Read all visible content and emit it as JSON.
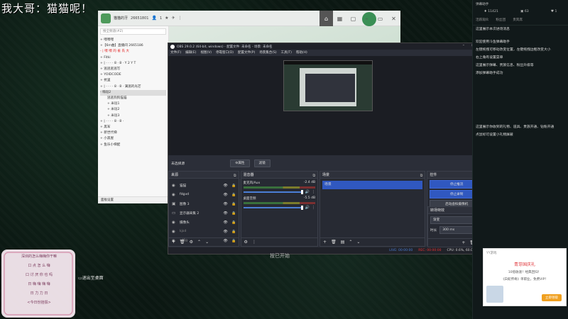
{
  "stream_title": "我大哥：猫猫呢！",
  "chat": {
    "user_name": "猫猫的牙",
    "user_id": "26651801",
    "member_count": "1",
    "search_placeholder": "搜全频道(#Z)",
    "tree": [
      {
        "label": "+ 嘿嘿嘿",
        "cls": ""
      },
      {
        "label": "+【6m曲】直播间 2665186",
        "cls": ""
      },
      {
        "label": "- | 嘿 嘿 的 雀 氏 大",
        "cls": "red"
      },
      {
        "label": "+ Fitki",
        "cls": ""
      },
      {
        "label": "+ | · · · · 8 · 8 · Y 2 Y T",
        "cls": ""
      },
      {
        "label": "+ 逃逃逃逃写",
        "cls": ""
      },
      {
        "label": "+ YOIDCODE",
        "cls": ""
      },
      {
        "label": "+ 抗里",
        "cls": ""
      },
      {
        "label": "+ | · · · · 8 · 8 · 满逃的光芒",
        "cls": ""
      },
      {
        "label": "- 嗨逗2",
        "cls": "hl"
      },
      {
        "label": "逃逃狗狗猫猫",
        "cls": "sub"
      },
      {
        "label": "+ 米逗1",
        "cls": "sub"
      },
      {
        "label": "+ 米逗2",
        "cls": "sub"
      },
      {
        "label": "+ 米逗3",
        "cls": "sub"
      },
      {
        "label": "+ | · · · · 8 · 8 ·",
        "cls": ""
      },
      {
        "label": "+ 黑军",
        "cls": ""
      },
      {
        "label": "+ 新世代梯",
        "cls": ""
      },
      {
        "label": "+ 小黑屋",
        "cls": ""
      },
      {
        "label": "+ 鱼乐小梯配",
        "cls": ""
      }
    ],
    "bottom_label": "面板设置"
  },
  "obs": {
    "title": "OBS 29.0.2 (64-bit, windows) - 配置文件: 未命名 - 场景: 未命名",
    "menu": [
      "文件(F)",
      "编辑(E)",
      "视图(V)",
      "停靠窗口(D)",
      "配置文件(P)",
      "场景集合(S)",
      "工具(T)",
      "帮助(H)"
    ],
    "no_source": "未选择源",
    "props_btn": "⚙属性",
    "filter_btn": "滤镜",
    "docks": {
      "sources": {
        "title": "来源",
        "items": [
          {
            "icon": "◉",
            "name": "猫猫",
            "dim": false
          },
          {
            "icon": "◉",
            "name": "fdgvd",
            "dim": false
          },
          {
            "icon": "▣",
            "name": "图像 3",
            "dim": false
          },
          {
            "icon": "▭",
            "name": "显示器采集 2",
            "dim": false
          },
          {
            "icon": "◉",
            "name": "摄像头",
            "dim": false
          },
          {
            "icon": "◉",
            "name": "kjsd",
            "dim": true
          },
          {
            "icon": "◉",
            "name": "sdfjg",
            "dim": true
          }
        ]
      },
      "mixer": {
        "title": "混音器",
        "channels": [
          {
            "name": "麦克风/Aux",
            "db": "-2.4 dB"
          },
          {
            "name": "桌面音频",
            "db": "-5.5 dB"
          }
        ]
      },
      "scenes": {
        "title": "场景",
        "items": [
          "场景"
        ]
      },
      "controls": {
        "title": "控件",
        "buttons": [
          "停止推流",
          "停止录制",
          "启动虚拟摄像机",
          "工作室模式",
          "设置",
          "退出"
        ]
      },
      "transitions": {
        "title": "转场特效",
        "selected": "渐变",
        "duration_label": "时长",
        "duration_value": "300 ms"
      }
    },
    "status": {
      "live": "LIVE: 00:00:00",
      "rec": "REC: 00:00:00",
      "cpu": "CPU: 0.6%, 60.00 fps"
    }
  },
  "right_panel": {
    "header": "弹幕助手",
    "stats": [
      "11421",
      "63",
      "1"
    ],
    "tabs": [
      "活跃观众",
      "粉丝团",
      "贵宾席"
    ],
    "messages": [
      "这里展示本次进场消息",
      "",
      "欢迎使用斗鱼弹幕助手",
      "左键拖拽可移动改变位置，左键拖拽边框改变大小",
      "右上角有设置菜单",
      "这里展示弹幕、贵族信息、粉丝升级等",
      "添加弹幕助手成功"
    ],
    "messages2": [
      "这里展示你收到的礼物、道具、贵族开通、钻粉开通",
      "点鼠标可设置小礼物屏蔽"
    ]
  },
  "center_label": "按已开始",
  "exit_label": "▭退出至桌面",
  "stamp_lines": [
    "深圳的怎么嗨嗨你干嘛",
    "口 点 怎 么 嗨",
    "口 讨 厌 你 也 吗",
    "日 嗨 嗨 嗨 嗨",
    "日 力 力 日",
    "<今日份拾掇>"
  ],
  "ad": {
    "header": "YY游戏",
    "title": "青芽国庆礼",
    "line1": "10倍收速！经典回归！",
    "line2": "《白蛇传奇》单职业，免费VIP！",
    "button": "立即领取"
  }
}
